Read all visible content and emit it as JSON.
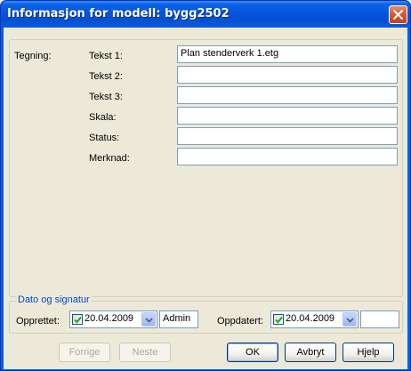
{
  "window": {
    "title": "Informasjon for modell: bygg2502"
  },
  "drawing": {
    "section_label": "Tegning:",
    "fields": [
      {
        "label": "Tekst 1:",
        "value": "Plan stenderverk 1.etg"
      },
      {
        "label": "Tekst 2:",
        "value": ""
      },
      {
        "label": "Tekst 3:",
        "value": ""
      },
      {
        "label": "Skala:",
        "value": ""
      },
      {
        "label": "Status:",
        "value": ""
      },
      {
        "label": "Merknad:",
        "value": ""
      }
    ]
  },
  "date_signature": {
    "legend": "Dato og signatur",
    "created_label": "Opprettet:",
    "created_date": "20.04.2009",
    "created_checked": true,
    "created_signature": "Admin",
    "updated_label": "Oppdatert:",
    "updated_date": "20.04.2009",
    "updated_checked": true,
    "updated_signature": ""
  },
  "buttons": {
    "previous": "Forrige",
    "next": "Neste",
    "ok": "OK",
    "cancel": "Avbryt",
    "help": "Hjelp"
  }
}
